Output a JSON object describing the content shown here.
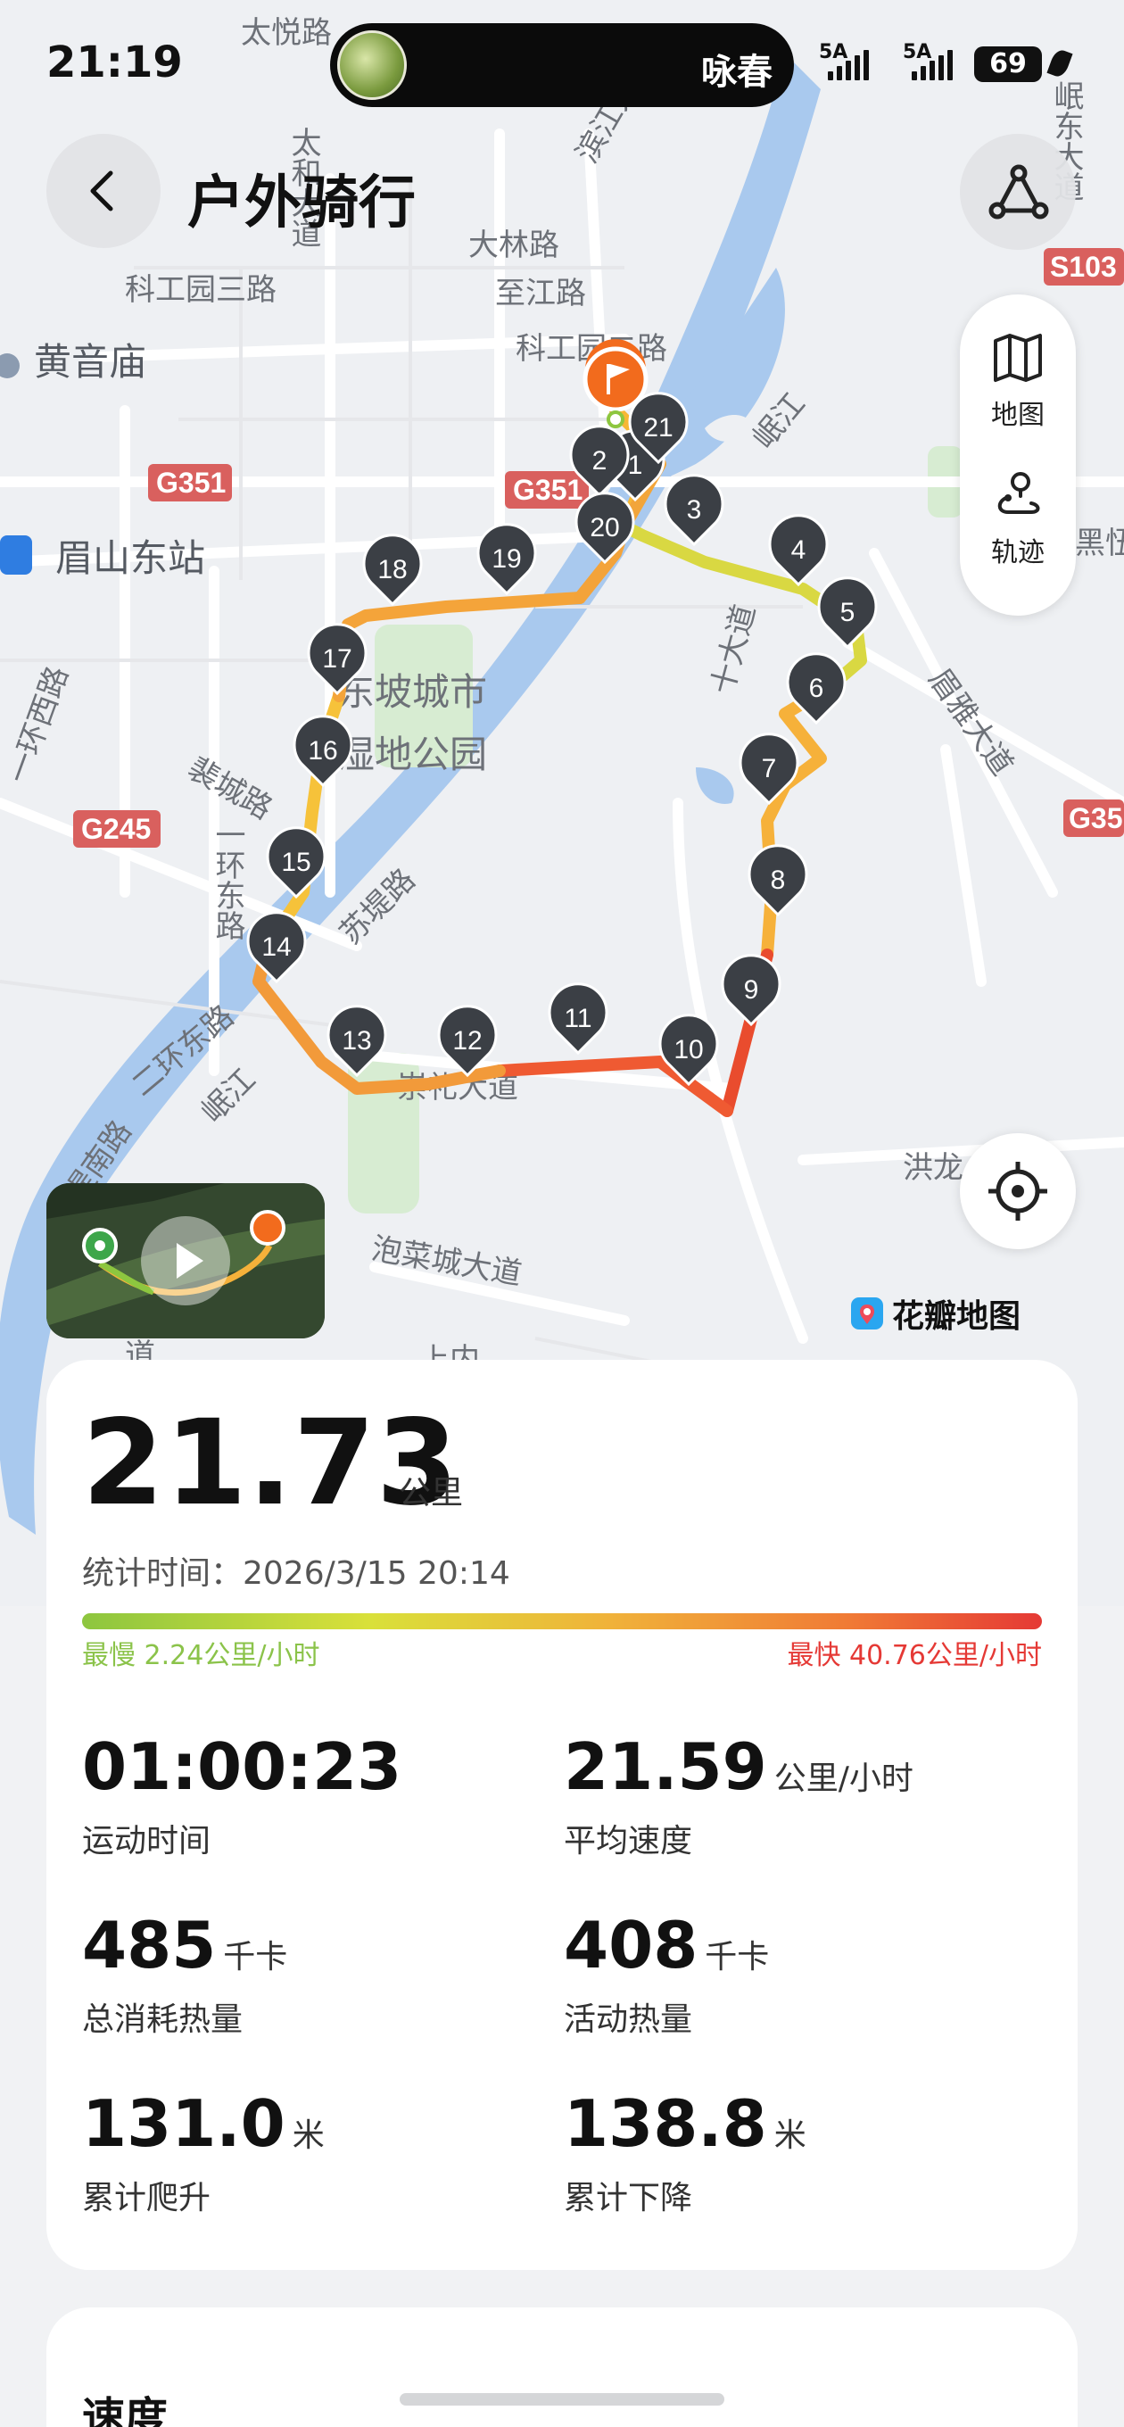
{
  "status_bar": {
    "time": "21:19",
    "island_text": "咏春",
    "signal1_label": "5A",
    "signal2_label": "5A",
    "battery": "69"
  },
  "header": {
    "title": "户外骑行"
  },
  "map": {
    "labels": {
      "taiyue": "太悦路",
      "taihe": "太和大道",
      "binjiang": "滨江大道",
      "dalin": "大林路",
      "zhijiang": "至江路",
      "kegong3": "科工园三路",
      "kegong2": "科工园二路",
      "huangyin": "黄音庙",
      "g351a": "G351",
      "g351b": "G351",
      "s103": "S103",
      "minjiang1": "岷江",
      "meishan_east": "眉山东站",
      "peicheng": "裴城路",
      "huan1west": "一环西路",
      "g245": "G245",
      "huan1east": "一环东路",
      "park": "东坡城市湿地公园",
      "sudi": "苏堤路",
      "huan2east": "二环东路",
      "minjiang2": "岷江",
      "dinan": "堤南路",
      "chongli": "崇礼大道",
      "paocai": "泡菜城大道",
      "hongle": "洪龙",
      "meixi": "眉雅大道",
      "minjiang3": "岷东大道",
      "g35": "G35",
      "heiyi": "黑忸",
      "shida": "十大道",
      "dao": "道",
      "shangmi": "上内"
    },
    "markers": [
      "1",
      "2",
      "3",
      "4",
      "5",
      "6",
      "7",
      "8",
      "9",
      "10",
      "11",
      "12",
      "13",
      "14",
      "15",
      "16",
      "17",
      "18",
      "19",
      "20",
      "21"
    ],
    "layers": {
      "map_label": "地图",
      "track_label": "轨迹"
    },
    "attribution": "花瓣地图"
  },
  "summary": {
    "distance": "21.73",
    "distance_unit": "公里",
    "stat_time": "统计时间：2026/3/15 20:14",
    "slowest": "最慢 2.24公里/小时",
    "fastest": "最快 40.76公里/小时",
    "metrics": [
      {
        "value": "01:00:23",
        "unit": "",
        "label": "运动时间"
      },
      {
        "value": "21.59",
        "unit": "公里/小时",
        "label": "平均速度"
      },
      {
        "value": "485",
        "unit": "千卡",
        "label": "总消耗热量"
      },
      {
        "value": "408",
        "unit": "千卡",
        "label": "活动热量"
      },
      {
        "value": "131.0",
        "unit": "米",
        "label": "累计爬升"
      },
      {
        "value": "138.8",
        "unit": "米",
        "label": "累计下降"
      }
    ]
  },
  "speed_section": {
    "title": "速度"
  },
  "colors": {
    "slow": "#8bc34a",
    "fast": "#e53935",
    "marker": "#3b3f45",
    "flag": "#f26b1d"
  }
}
